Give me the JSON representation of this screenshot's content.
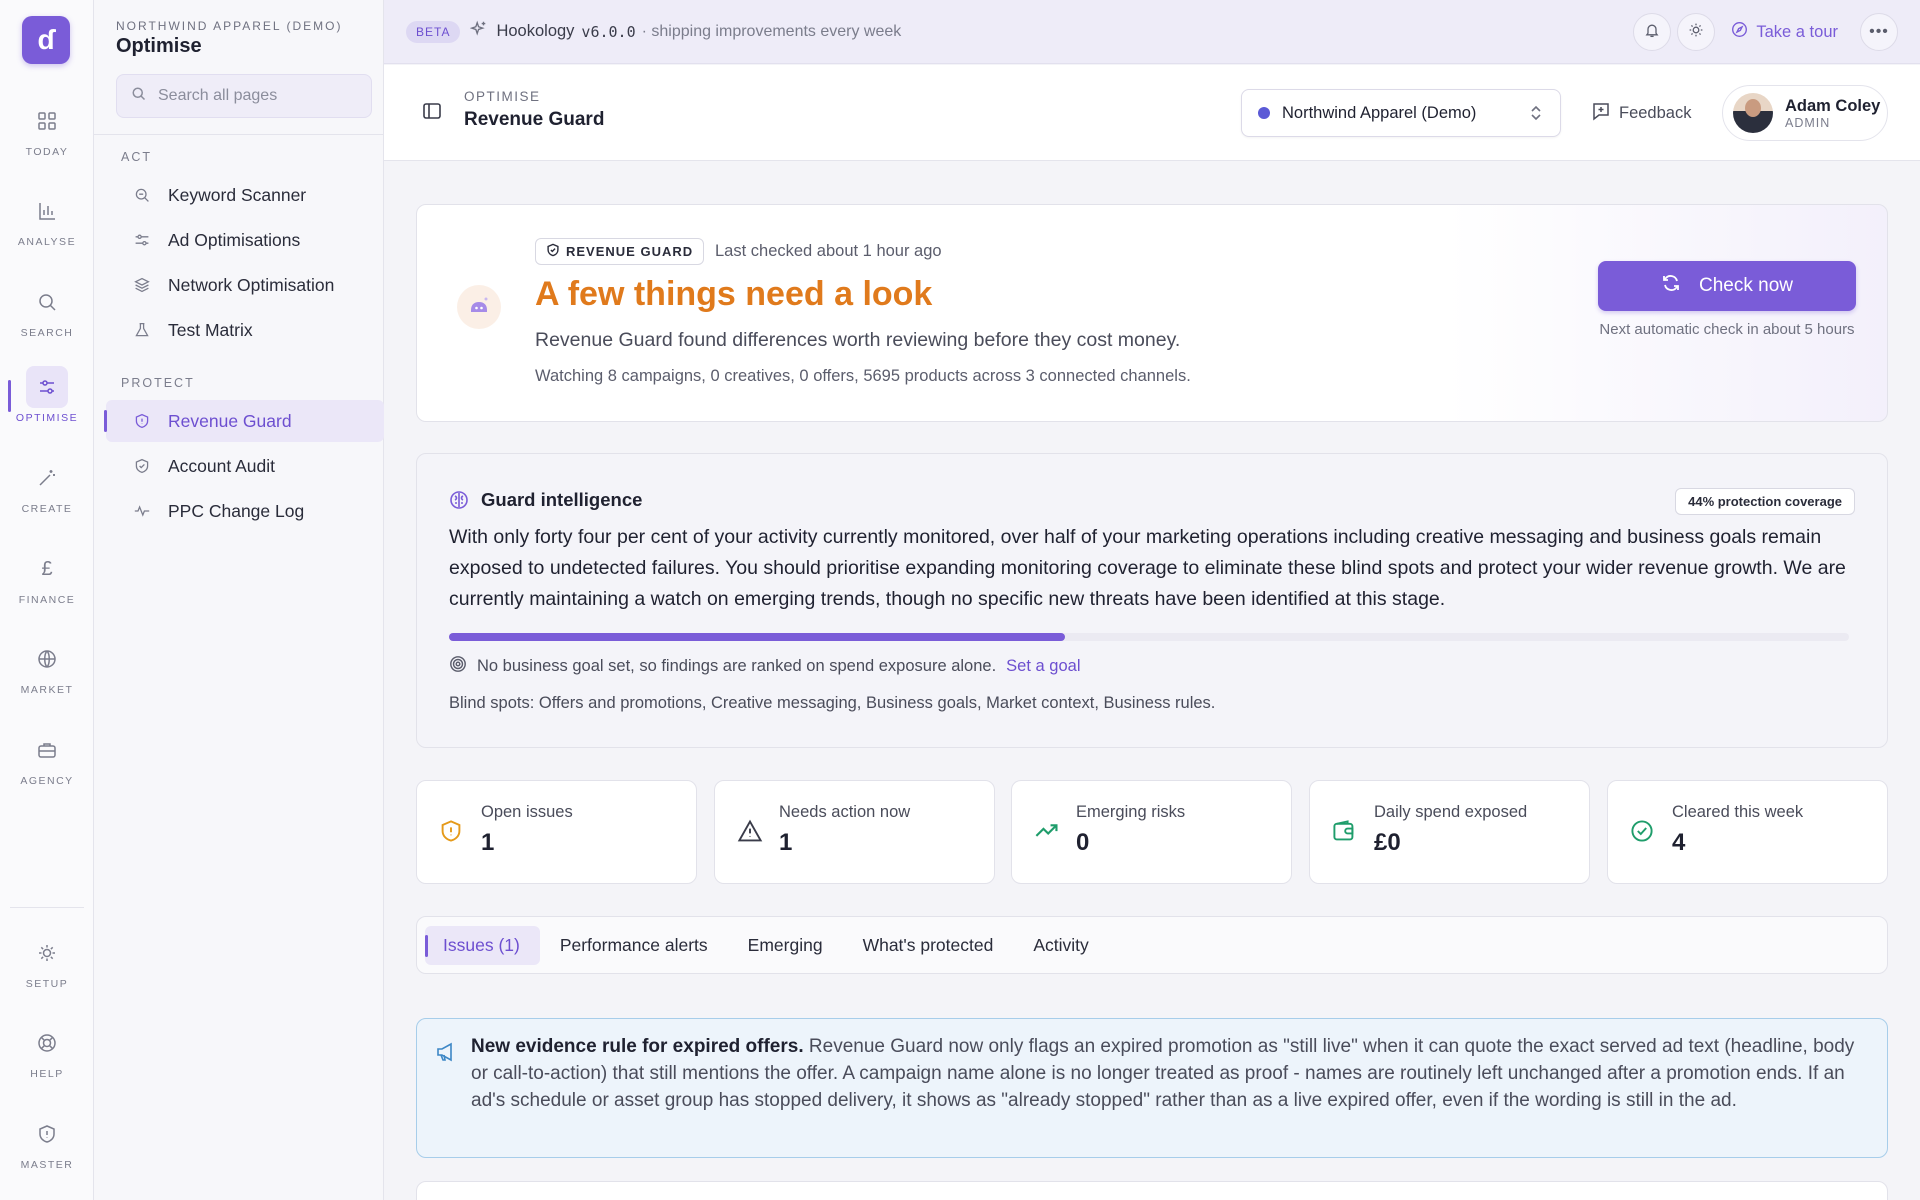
{
  "rail": {
    "logo": "ɗ",
    "items": [
      {
        "label": "TODAY",
        "icon": "grid-icon"
      },
      {
        "label": "ANALYSE",
        "icon": "bar-chart-icon"
      },
      {
        "label": "SEARCH",
        "icon": "search-icon"
      },
      {
        "label": "OPTIMISE",
        "icon": "sliders-icon"
      },
      {
        "label": "CREATE",
        "icon": "magic-wand-icon"
      },
      {
        "label": "FINANCE",
        "icon": "pound-icon"
      },
      {
        "label": "MARKET",
        "icon": "globe-icon"
      },
      {
        "label": "AGENCY",
        "icon": "briefcase-icon"
      },
      {
        "label": "SETUP",
        "icon": "sun-gear-icon"
      },
      {
        "label": "HELP",
        "icon": "lifebuoy-icon"
      },
      {
        "label": "MASTER",
        "icon": "shield-icon"
      }
    ]
  },
  "nav": {
    "org": "NORTHWIND APPAREL (DEMO)",
    "title": "Optimise",
    "search_placeholder": "Search all pages",
    "section_act": "ACT",
    "act_items": [
      "Keyword Scanner",
      "Ad Optimisations",
      "Network Optimisation",
      "Test Matrix"
    ],
    "section_protect": "PROTECT",
    "protect_items": [
      "Revenue Guard",
      "Account Audit",
      "PPC Change Log"
    ]
  },
  "banner": {
    "beta": "BETA",
    "product": "Hookology",
    "version": "v6.0.0",
    "tagline": "· shipping improvements every week",
    "tour": "Take a tour"
  },
  "header": {
    "section": "OPTIMISE",
    "title": "Revenue Guard",
    "account": "Northwind Apparel (Demo)",
    "feedback": "Feedback",
    "user_name": "Adam Coley",
    "user_role": "ADMIN"
  },
  "hero": {
    "badge": "REVENUE GUARD",
    "last_checked": "Last checked about 1 hour ago",
    "title": "A few things need a look",
    "description": "Revenue Guard found differences worth reviewing before they cost money.",
    "watching": "Watching 8 campaigns, 0 creatives, 0 offers, 5695 products across 3 connected channels.",
    "check_button": "Check now",
    "next_check": "Next automatic check in about 5 hours"
  },
  "intel": {
    "title": "Guard intelligence",
    "coverage_badge": "44% protection coverage",
    "coverage_fraction": 0.44,
    "body": "With only forty four per cent of your activity currently monitored, over half of your marketing operations including creative messaging and business goals remain exposed to undetected failures. You should prioritise expanding monitoring coverage to eliminate these blind spots and protect your wider revenue growth. We are currently maintaining a watch on emerging trends, though no specific new threats have been identified at this stage.",
    "goal_text": "No business goal set, so findings are ranked on spend exposure alone.",
    "goal_link": "Set a goal",
    "blind_spots": "Blind spots: Offers and promotions, Creative messaging, Business goals, Market context, Business rules."
  },
  "stats": [
    {
      "label": "Open issues",
      "value": "1",
      "icon": "shield-alert-icon",
      "color": "#e59a1a"
    },
    {
      "label": "Needs action now",
      "value": "1",
      "icon": "warning-triangle-icon",
      "color": "#3a3c4a"
    },
    {
      "label": "Emerging risks",
      "value": "0",
      "icon": "trend-up-icon",
      "color": "#1f9d6b"
    },
    {
      "label": "Daily spend exposed",
      "value": "£0",
      "icon": "wallet-icon",
      "color": "#1f9d6b"
    },
    {
      "label": "Cleared this week",
      "value": "4",
      "icon": "check-circle-icon",
      "color": "#1f9d6b"
    }
  ],
  "tabs": [
    "Issues (1)",
    "Performance alerts",
    "Emerging",
    "What's protected",
    "Activity"
  ],
  "notice": {
    "lead": "New evidence rule for expired offers.",
    "body": " Revenue Guard now only flags an expired promotion as \"still live\" when it can quote the exact served ad text (headline, body or call-to-action) that still mentions the offer. A campaign name alone is no longer treated as proof - names are routinely left unchanged after a promotion ends. If an ad's schedule or asset group has stopped delivery, it shows as \"already stopped\" rather than as a live expired offer, even if the wording is still in the ad."
  },
  "colors": {
    "accent": "#7a5cd8",
    "warning": "#e07a1c",
    "success": "#1f9d6b",
    "info": "#3d87c6"
  }
}
